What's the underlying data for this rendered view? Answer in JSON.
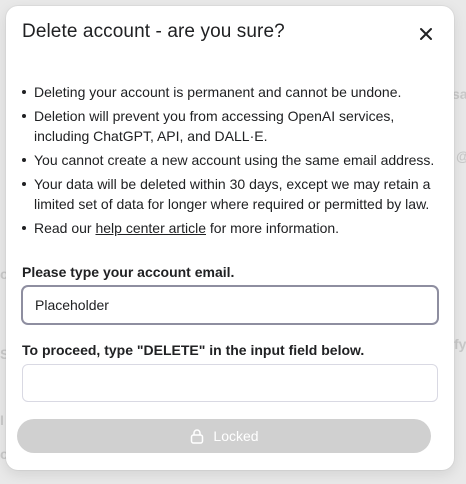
{
  "background": {
    "ghost_texts": [
      "sa",
      "@",
      "o",
      "fy",
      "S",
      "I",
      "o"
    ]
  },
  "modal": {
    "title": "Delete account - are you sure?",
    "close_icon": "close-icon",
    "points": [
      "Deleting your account is permanent and cannot be undone.",
      "Deletion will prevent you from accessing OpenAI services, including ChatGPT, API, and DALL·E.",
      "You cannot create a new account using the same email address.",
      "Your data will be deleted within 30 days, except we may retain a limited set of data for longer where required or permitted by law."
    ],
    "read_more": {
      "prefix": "Read our ",
      "link": "help center article",
      "suffix": " for more information."
    },
    "email_field": {
      "label": "Please type your account email.",
      "value": "Placeholder",
      "placeholder": ""
    },
    "confirm_field": {
      "label": "To proceed, type \"DELETE\" in the input field below.",
      "value": "",
      "placeholder": ""
    },
    "submit_button": {
      "label": "Locked",
      "icon": "lock-icon"
    }
  },
  "colors": {
    "text": "#202123",
    "button_disabled": "#d0d0d0",
    "input_border_active": "#8e8ea0",
    "input_border": "#d9d9e3"
  }
}
